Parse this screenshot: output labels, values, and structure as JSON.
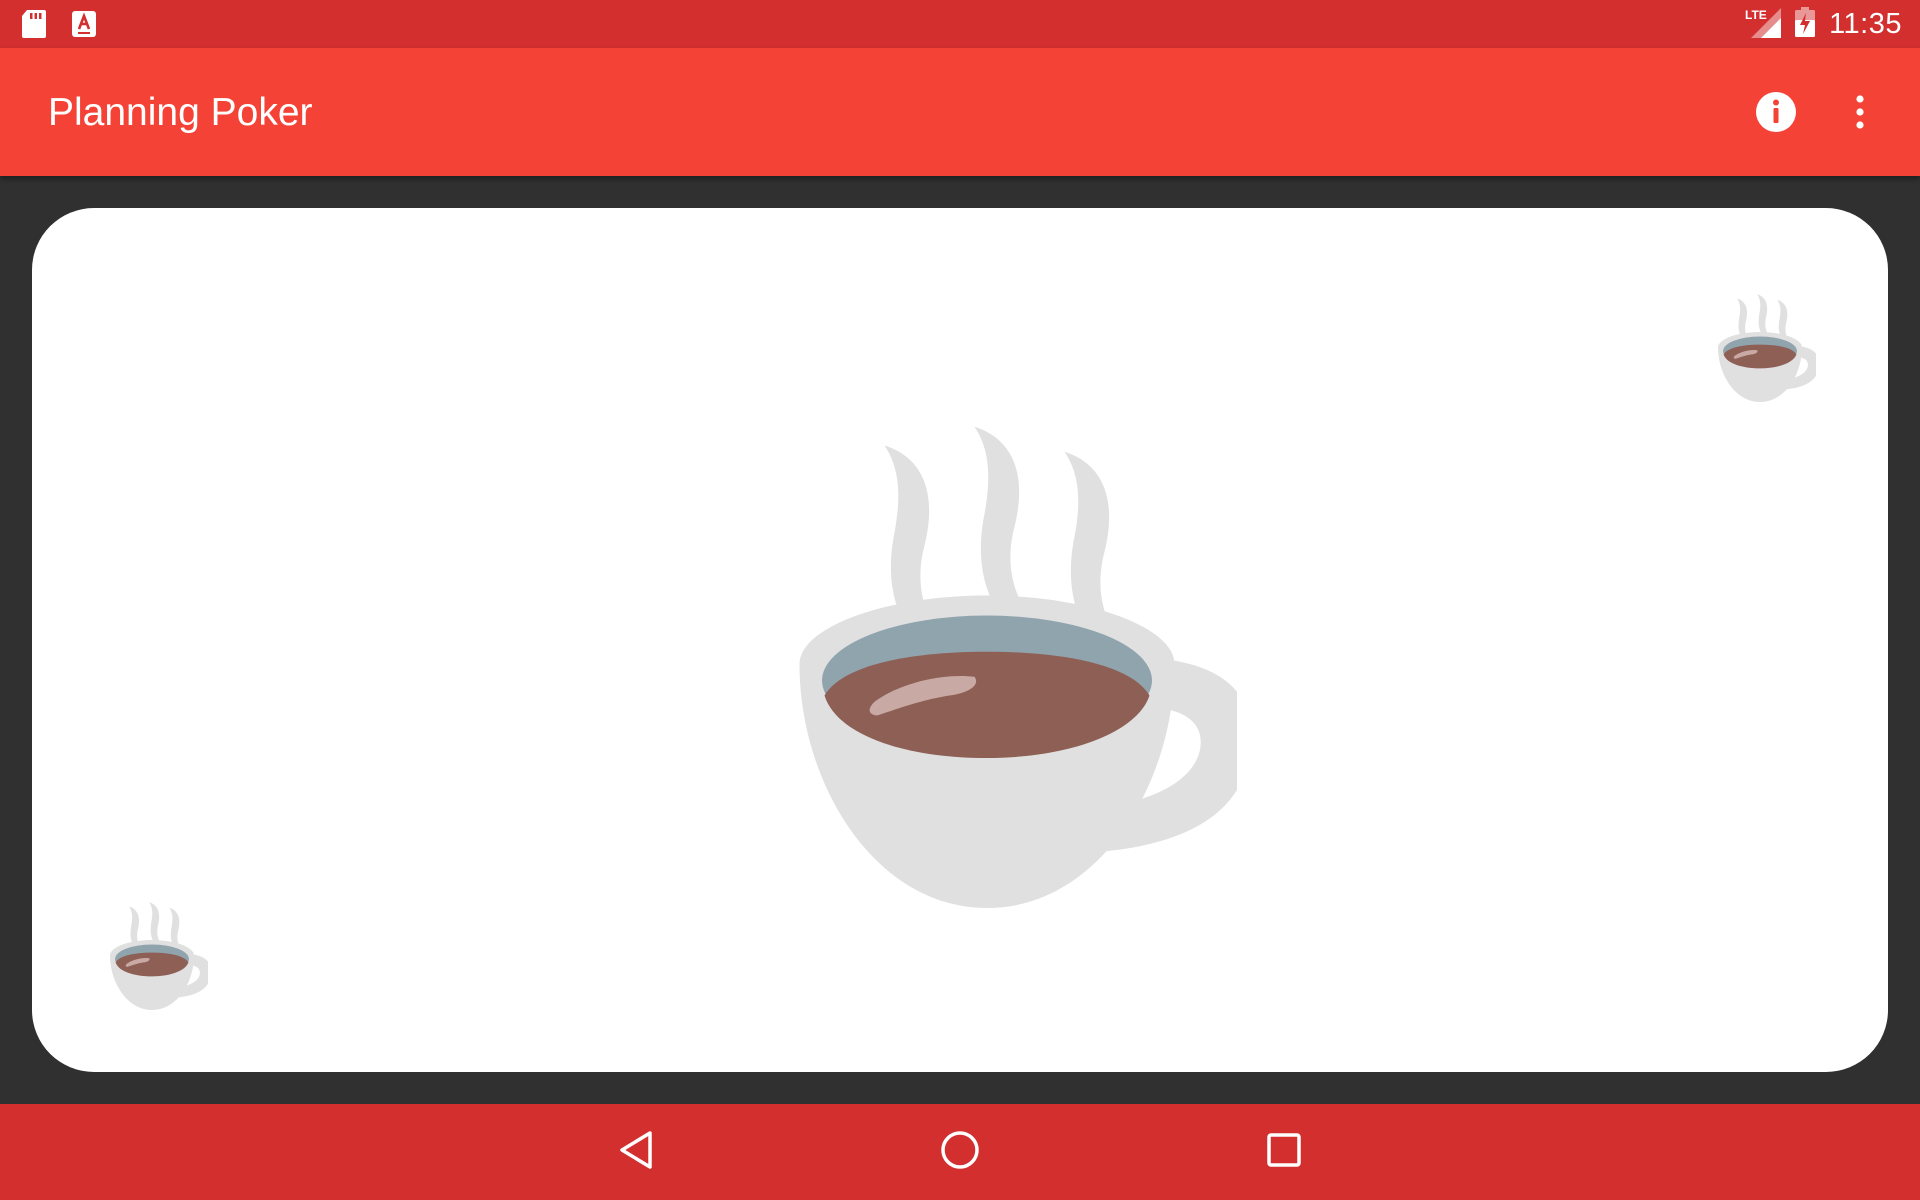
{
  "status_bar": {
    "time": "11:35",
    "icons": [
      "sd-card-icon",
      "text-notification-icon",
      "lte-signal-icon",
      "battery-charging-icon"
    ],
    "network_label": "LTE",
    "color": "#d32f2f"
  },
  "app_bar": {
    "title": "Planning Poker",
    "actions": [
      "info-icon",
      "overflow-menu-icon"
    ],
    "color": "#f44336"
  },
  "card": {
    "value": "coffee-cup-icon",
    "background": "#ffffff"
  },
  "nav_bar": {
    "buttons": [
      "back-icon",
      "home-icon",
      "recents-icon"
    ],
    "color": "#d32f2f"
  }
}
